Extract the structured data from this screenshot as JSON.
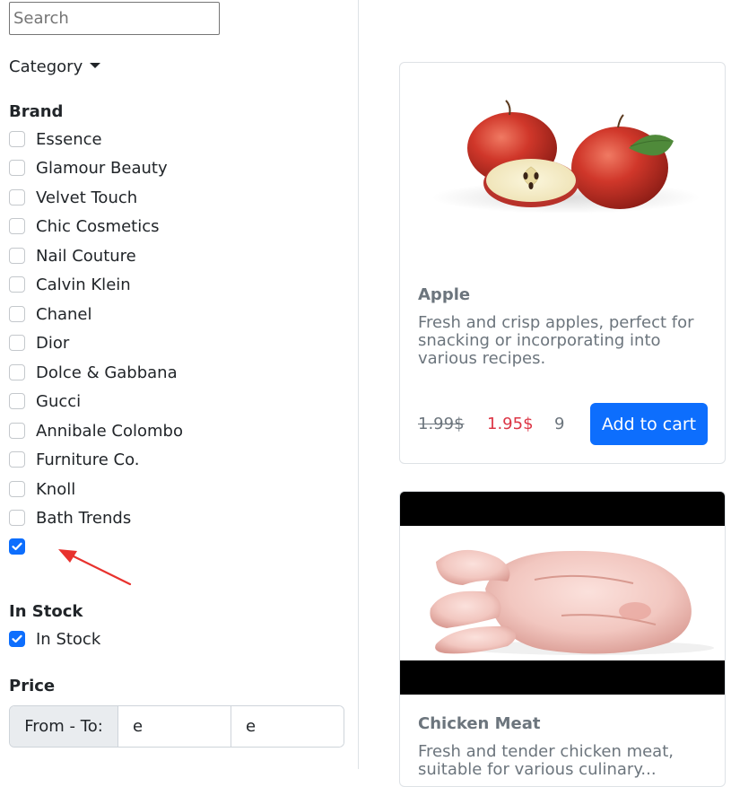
{
  "search": {
    "placeholder": "Search",
    "value": ""
  },
  "category": {
    "label": "Category"
  },
  "brand": {
    "heading": "Brand",
    "items": [
      {
        "label": "Essence",
        "checked": false
      },
      {
        "label": "Glamour Beauty",
        "checked": false
      },
      {
        "label": "Velvet Touch",
        "checked": false
      },
      {
        "label": "Chic Cosmetics",
        "checked": false
      },
      {
        "label": "Nail Couture",
        "checked": false
      },
      {
        "label": "Calvin Klein",
        "checked": false
      },
      {
        "label": "Chanel",
        "checked": false
      },
      {
        "label": "Dior",
        "checked": false
      },
      {
        "label": "Dolce & Gabbana",
        "checked": false
      },
      {
        "label": "Gucci",
        "checked": false
      },
      {
        "label": "Annibale Colombo",
        "checked": false
      },
      {
        "label": "Furniture Co.",
        "checked": false
      },
      {
        "label": "Knoll",
        "checked": false
      },
      {
        "label": "Bath Trends",
        "checked": false
      },
      {
        "label": "",
        "checked": true
      }
    ]
  },
  "in_stock": {
    "heading": "In Stock",
    "label": "In Stock",
    "checked": true
  },
  "price": {
    "heading": "Price",
    "label": "From - To:",
    "from": "e",
    "to": "e"
  },
  "products": [
    {
      "title": "Apple",
      "description": "Fresh and crisp apples, perfect for snacking or incorporating into various recipes.",
      "old_price": "1.99$",
      "price": "1.95$",
      "quantity": "9",
      "button": "Add to cart"
    },
    {
      "title": "Chicken Meat",
      "description": "Fresh and tender chicken meat, suitable for various culinary..."
    }
  ],
  "colors": {
    "accent": "#0d6efd",
    "sale": "#dc3545",
    "muted": "#6c757d",
    "arrow": "#e8322e"
  }
}
